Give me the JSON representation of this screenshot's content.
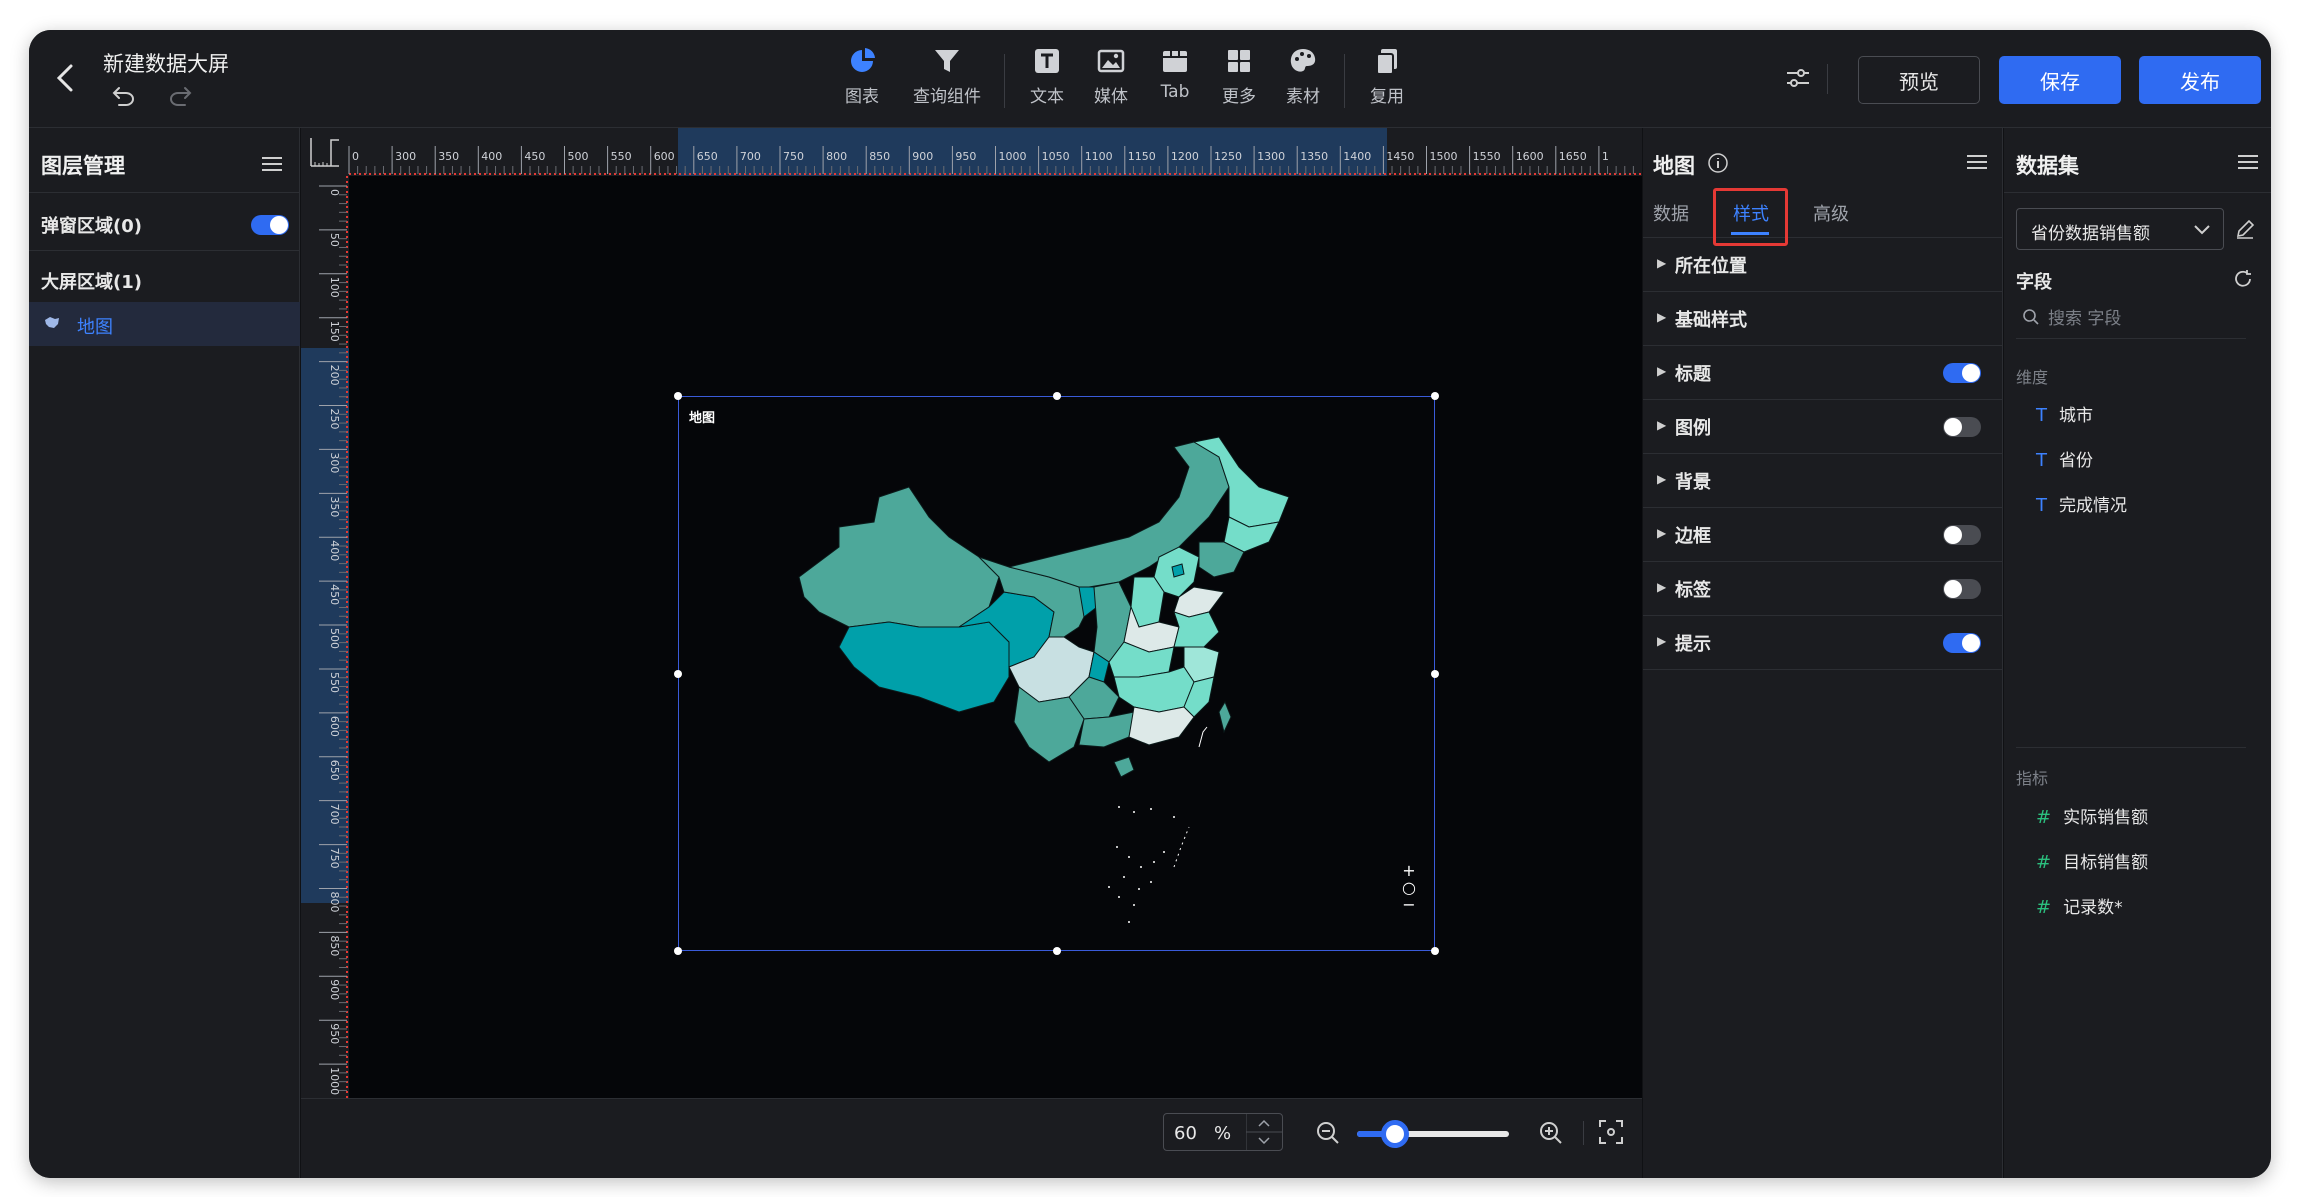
{
  "header": {
    "title": "新建数据大屏",
    "toolbar": [
      {
        "label": "图表",
        "icon": "pie-chart-icon"
      },
      {
        "label": "查询组件",
        "icon": "filter-icon"
      },
      {
        "label": "文本",
        "icon": "text-icon"
      },
      {
        "label": "媒体",
        "icon": "image-icon"
      },
      {
        "label": "Tab",
        "icon": "tab-icon"
      },
      {
        "label": "更多",
        "icon": "grid-icon"
      },
      {
        "label": "素材",
        "icon": "palette-icon"
      },
      {
        "label": "复用",
        "icon": "copy-icon"
      }
    ],
    "preview_label": "预览",
    "save_label": "保存",
    "publish_label": "发布"
  },
  "layers": {
    "title": "图层管理",
    "popup_area": "弹窗区域(0)",
    "popup_toggle": true,
    "screen_area": "大屏区域(1)",
    "items": [
      {
        "label": "地图",
        "icon": "map-icon",
        "selected": true
      }
    ]
  },
  "ruler": {
    "top_labels": [
      "0",
      "300",
      "350",
      "400",
      "450",
      "500",
      "550",
      "600",
      "650",
      "700",
      "750",
      "800",
      "850",
      "900",
      "950",
      "1000",
      "1050",
      "1100",
      "1150",
      "1200",
      "1250",
      "1300",
      "1350",
      "1400",
      "1450",
      "1500",
      "1550",
      "1600",
      "1650",
      "1"
    ],
    "left_labels": [
      "0",
      "50",
      "100",
      "150",
      "200",
      "250",
      "300",
      "350",
      "400",
      "450",
      "500",
      "550",
      "600",
      "650",
      "700",
      "750",
      "800",
      "850",
      "900",
      "950",
      "1000"
    ]
  },
  "widget": {
    "title": "地图",
    "controls": [
      "+",
      "○",
      "−"
    ]
  },
  "zoom": {
    "value": "60",
    "unit": "%",
    "level": 0.25
  },
  "props": {
    "title": "地图",
    "tabs": [
      {
        "label": "数据",
        "active": false
      },
      {
        "label": "样式",
        "active": true
      },
      {
        "label": "高级",
        "active": false
      }
    ],
    "sections": [
      {
        "label": "所在位置"
      },
      {
        "label": "基础样式"
      },
      {
        "label": "标题",
        "toggle": true
      },
      {
        "label": "图例",
        "toggle": false
      },
      {
        "label": "背景"
      },
      {
        "label": "边框",
        "toggle": false
      },
      {
        "label": "标签",
        "toggle": false
      },
      {
        "label": "提示",
        "toggle": true
      }
    ]
  },
  "dataset": {
    "title": "数据集",
    "selected": "省份数据销售额",
    "field_label": "字段",
    "search_placeholder": "搜索 字段",
    "dimensions_label": "维度",
    "dimensions": [
      "城市",
      "省份",
      "完成情况"
    ],
    "metrics_label": "指标",
    "metrics": [
      "实际销售额",
      "目标销售额",
      "记录数*"
    ]
  },
  "colors": {
    "accent": "#2f6bf2",
    "highlight_box": "#e53935",
    "map_teal_dark": "#00a0aa",
    "map_teal_mid": "#4da89a",
    "map_teal_light": "#74ddc9",
    "map_pale": "#dde9e8"
  }
}
